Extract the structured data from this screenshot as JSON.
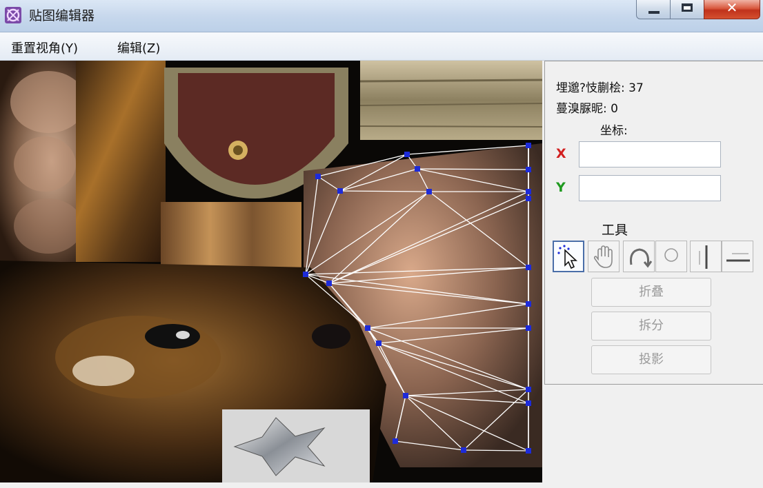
{
  "window": {
    "title": "贴图编辑器",
    "close_glyph": "✕",
    "icon": "app-texture-icon"
  },
  "menu": {
    "items": [
      "重置视角(Y)",
      "编辑(Z)"
    ]
  },
  "panel": {
    "info_line_1": "埋邈?忮蒯桧: 37",
    "info_line_2": "蔓溴脲昵: 0",
    "coord_label": "坐标:",
    "x_label": "X",
    "y_label": "Y",
    "x_value": "",
    "y_value": "",
    "tools_label": "工具",
    "tools": [
      {
        "name": "select-tool-icon",
        "active": true
      },
      {
        "name": "hand-pan-tool-icon",
        "active": false
      },
      {
        "name": "rotate-tool-icon",
        "active": false
      },
      {
        "name": "circle-tool-icon",
        "active": false
      },
      {
        "name": "vertical-mirror-tool-icon",
        "active": false
      },
      {
        "name": "horizontal-mirror-tool-icon",
        "active": false
      }
    ],
    "buttons": [
      "折叠",
      "拆分",
      "投影"
    ]
  },
  "colors": {
    "vertex": "#1d2bd9",
    "wire": "#ffffff",
    "x_axis": "#d21f1f",
    "y_axis": "#1f9a1f"
  }
}
